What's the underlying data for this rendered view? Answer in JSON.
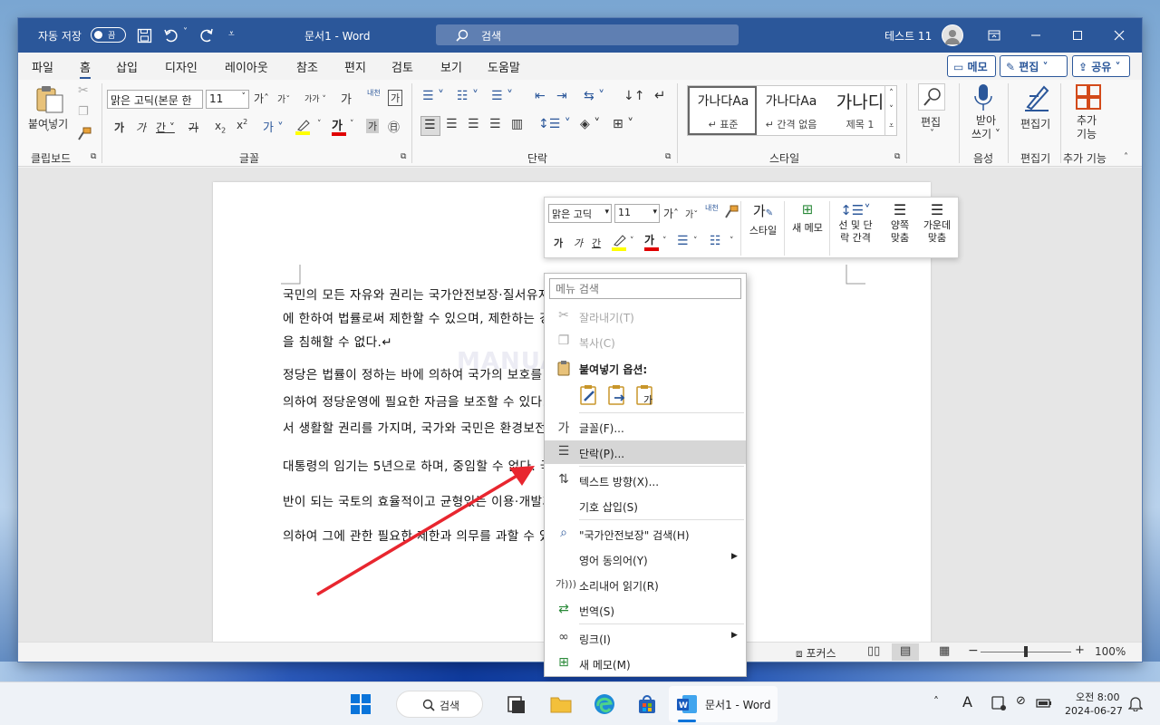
{
  "titlebar": {
    "autosave_label": "자동 저장",
    "autosave_state": "끔",
    "document_title": "문서1 - Word",
    "search_label": "검색",
    "user_name": "테스트 11"
  },
  "tabs": [
    "파일",
    "홈",
    "삽입",
    "디자인",
    "레이아웃",
    "참조",
    "편지",
    "검토",
    "보기",
    "도움말"
  ],
  "tab_buttons": {
    "comments": "메모",
    "editing": "편집",
    "share": "공유"
  },
  "ribbon": {
    "clipboard": {
      "paste": "붙여넣기",
      "group": "클립보드"
    },
    "font": {
      "name": "맑은 고딕(본문 한",
      "size": "11",
      "group": "글꼴",
      "bold": "가",
      "italic": "가",
      "underline": "간",
      "strike": "가",
      "phonetic": "내천",
      "hanja": "가"
    },
    "paragraph": {
      "group": "단락"
    },
    "styles": {
      "group": "스타일",
      "items": [
        {
          "preview": "가나다Aa",
          "name": "↵ 표준"
        },
        {
          "preview": "가나다Aa",
          "name": "↵ 간격 없음"
        },
        {
          "preview": "가나디",
          "name": "제목 1"
        }
      ]
    },
    "editing": {
      "label": "편집"
    },
    "voice": {
      "label1": "받아",
      "label2": "쓰기",
      "group": "음성"
    },
    "editor": {
      "label": "편집기",
      "group": "편집기"
    },
    "addins": {
      "label1": "추가",
      "label2": "기능",
      "group": "추가 기능"
    }
  },
  "document": {
    "paragraphs": [
      [
        "국민의 모든 자유와 권리는 국가안전보장·질서유지 또는 공공복리를 위하여 필요한 경우",
        "에 한하여 법률로써 제한할 수 있으며, 제한하는 경우에도 자유와 권리의 본질적인 내용",
        "을 침해할 수 없다.↵"
      ],
      [
        "정당은 법률이 정하는 바에 의하여 국가의 보호를 받으며, 국가는 법률이 정하는 바에",
        "의하여 정당운영에 필요한 자금을 보조할 수 있다. 모든 국민은 건강하고 쾌적한 환경에",
        "서 생활할 권리를 가지며, 국가와 국민은 환경보전을 위하여 노력하여야 한다.↵"
      ],
      [
        "대통령의 임기는 5년으로 하며, 중임할 수 없다. 국가는 국민 모두의 생산 및 생활의 기",
        "반이 되는 국토의 효율적이고 균형있는 이용·개발과 보전을 위하여 법률이 정하는 바에",
        "의하여 그에 관한 필요한 제한과 의무를 과할 수 있다.↵"
      ]
    ],
    "watermark": "MANUAL FACTORY"
  },
  "mini_toolbar": {
    "font": "맑은 고딕",
    "size": "11",
    "style": "스타일",
    "new_comment": "새 메모",
    "line_spacing": [
      "선 및 단",
      "락 간격"
    ],
    "justify": [
      "양쪽",
      "맞춤"
    ],
    "center": [
      "가운데",
      "맞춤"
    ]
  },
  "context_menu": {
    "search_placeholder": "메뉴 검색",
    "paste_options_label": "붙여넣기 옵션:",
    "items": [
      {
        "label": "잘라내기(T)",
        "icon": "scissors-icon"
      },
      {
        "label": "복사(C)",
        "icon": "copy-icon"
      },
      {
        "label": "글꼴(F)...",
        "icon": "font-icon"
      },
      {
        "label": "단락(P)...",
        "icon": "paragraph-icon"
      },
      {
        "label": "텍스트 방향(X)...",
        "icon": "text-direction-icon"
      },
      {
        "label": "기호 삽입(S)",
        "icon": ""
      },
      {
        "label": "\"국가안전보장\" 검색(H)",
        "icon": "search-icon"
      },
      {
        "label": "영어 동의어(Y)",
        "icon": ""
      },
      {
        "label": "소리내어 읽기(R)",
        "icon": "read-aloud-icon"
      },
      {
        "label": "번역(S)",
        "icon": "translate-icon"
      },
      {
        "label": "링크(I)",
        "icon": "link-icon"
      },
      {
        "label": "새 메모(M)",
        "icon": "new-comment-icon"
      }
    ]
  },
  "statusbar": {
    "focus": "포커스",
    "zoom": "100%"
  },
  "taskbar": {
    "search": "검색",
    "word_app": "문서1 - Word",
    "ime": "A",
    "time": "오전 8:00",
    "date": "2024-06-27"
  },
  "colors": {
    "word_blue": "#2b579a",
    "highlight": "#ffff00",
    "font_red": "#e00000",
    "arrow_red": "#e8262f"
  }
}
